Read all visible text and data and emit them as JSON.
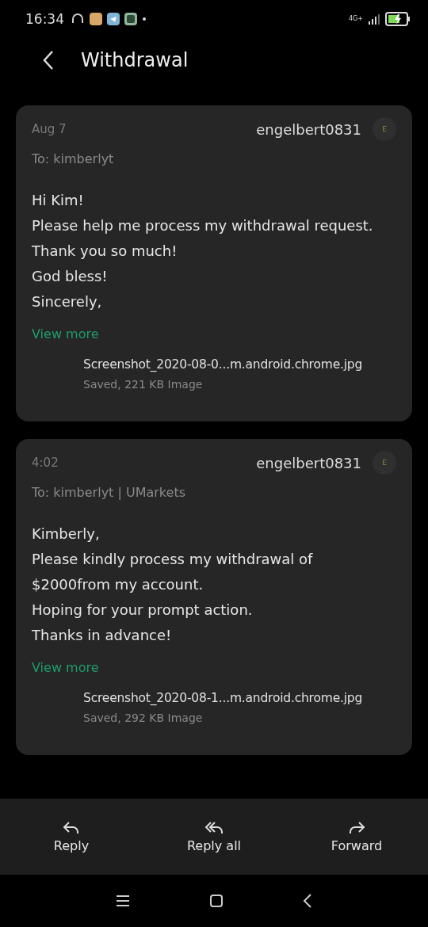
{
  "status_bar": {
    "time": "16:34",
    "network": "4G+"
  },
  "header": {
    "title": "Withdrawal"
  },
  "messages": [
    {
      "date": "Aug 7",
      "sender": "engelbert0831",
      "avatar": "E",
      "to": "To: kimberlyt",
      "body": [
        "Hi Kim!",
        "Please help me process my withdrawal request.",
        "Thank you so much!",
        "God bless!",
        "Sincerely,"
      ],
      "view_more": "View more",
      "attachment": {
        "name": "Screenshot_2020-08-0...m.android.chrome.jpg",
        "status": "Saved,",
        "size": "221 KB Image"
      }
    },
    {
      "date": "4:02",
      "sender": "engelbert0831",
      "avatar": "E",
      "to": "To: kimberlyt | UMarkets",
      "body": [
        "Kimberly,",
        "Please kindly process my withdrawal of",
        "$2000from my account.",
        "Hoping for your prompt action.",
        "Thanks in advance!"
      ],
      "view_more": "View more",
      "attachment": {
        "name": "Screenshot_2020-08-1...m.android.chrome.jpg",
        "status": "Saved,",
        "size": "292 KB Image"
      }
    }
  ],
  "actions": [
    {
      "kind": "reply",
      "label": "Reply"
    },
    {
      "kind": "reply_all",
      "label": "Reply all"
    },
    {
      "kind": "forward",
      "label": "Forward"
    }
  ]
}
